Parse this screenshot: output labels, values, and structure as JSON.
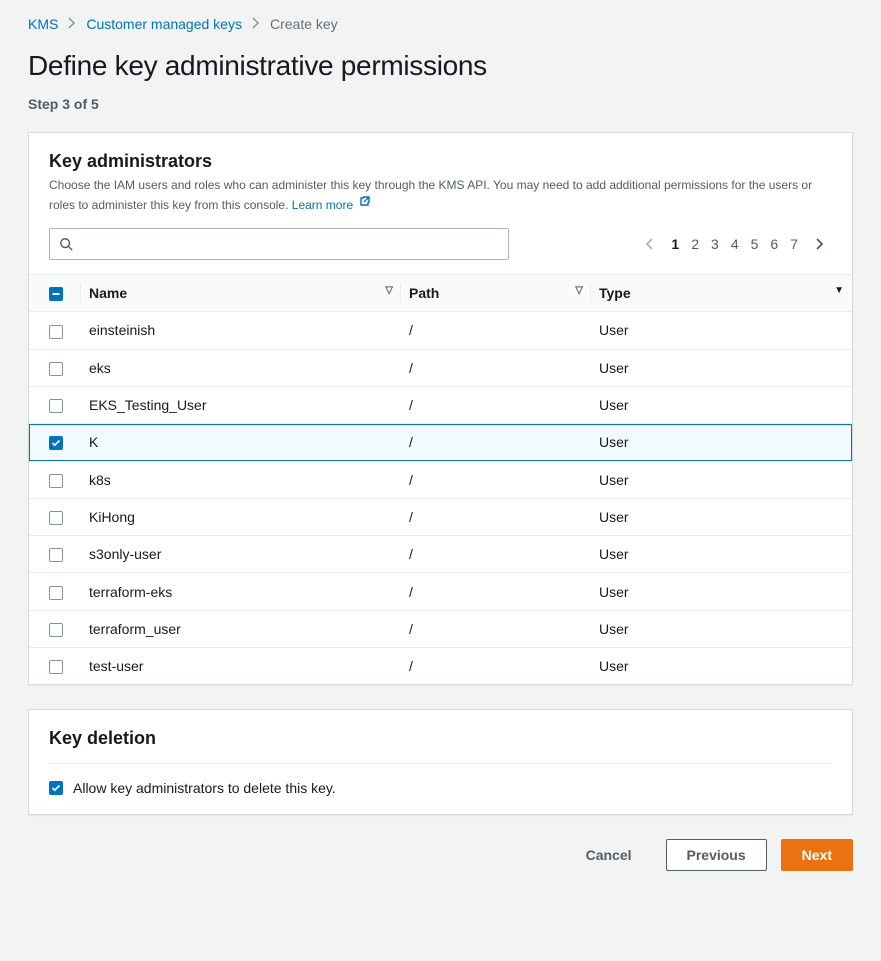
{
  "breadcrumb": {
    "items": [
      "KMS",
      "Customer managed keys",
      "Create key"
    ]
  },
  "heading": "Define key administrative permissions",
  "step_text": "Step 3 of 5",
  "admins": {
    "title": "Key administrators",
    "description": "Choose the IAM users and roles who can administer this key through the KMS API. You may need to add additional permissions for the users or roles to administer this key from this console.",
    "learn_more": "Learn more",
    "search_placeholder": "",
    "pagination": {
      "pages": [
        "1",
        "2",
        "3",
        "4",
        "5",
        "6",
        "7"
      ],
      "current": 1
    },
    "columns": {
      "name": "Name",
      "path": "Path",
      "type": "Type"
    },
    "rows": [
      {
        "name": "einsteinish",
        "path": "/",
        "type": "User",
        "checked": false
      },
      {
        "name": "eks",
        "path": "/",
        "type": "User",
        "checked": false
      },
      {
        "name": "EKS_Testing_User",
        "path": "/",
        "type": "User",
        "checked": false
      },
      {
        "name": "K",
        "path": "/",
        "type": "User",
        "checked": true
      },
      {
        "name": "k8s",
        "path": "/",
        "type": "User",
        "checked": false
      },
      {
        "name": "KiHong",
        "path": "/",
        "type": "User",
        "checked": false
      },
      {
        "name": "s3only-user",
        "path": "/",
        "type": "User",
        "checked": false
      },
      {
        "name": "terraform-eks",
        "path": "/",
        "type": "User",
        "checked": false
      },
      {
        "name": "terraform_user",
        "path": "/",
        "type": "User",
        "checked": false
      },
      {
        "name": "test-user",
        "path": "/",
        "type": "User",
        "checked": false
      }
    ]
  },
  "deletion": {
    "title": "Key deletion",
    "allow_label": "Allow key administrators to delete this key.",
    "allow_checked": true
  },
  "footer": {
    "cancel": "Cancel",
    "previous": "Previous",
    "next": "Next"
  }
}
